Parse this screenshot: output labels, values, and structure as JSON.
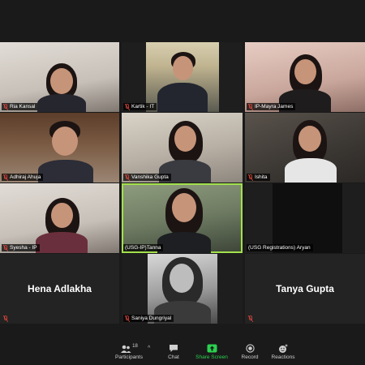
{
  "gallery": {
    "tiles": [
      {
        "name": "Ria Kansal",
        "muted": true
      },
      {
        "name": "Kartik - IT",
        "muted": true
      },
      {
        "name": "IP-Mayra James",
        "muted": true
      },
      {
        "name": "Adhiraj Ahuja",
        "muted": true
      },
      {
        "name": "Vanshika Gupta",
        "muted": true
      },
      {
        "name": "Ishita",
        "muted": true
      },
      {
        "name": "Syesha - IP",
        "muted": true
      },
      {
        "name": "(USG-IP)Tanna",
        "muted": false
      },
      {
        "name": "(USG Registrations) Aryan",
        "muted": false
      },
      {
        "name": "Hena Adlakha",
        "muted": true
      },
      {
        "name": "Saniya Dungriyal",
        "muted": true
      },
      {
        "name": "Tanya Gupta",
        "muted": true
      }
    ]
  },
  "toolbar": {
    "participants_label": "Participants",
    "participants_count": "18",
    "chat_label": "Chat",
    "share_label": "Share Screen",
    "record_label": "Record",
    "reactions_label": "Reactions",
    "caret": "^"
  },
  "colors": {
    "active_speaker": "#a3e14b",
    "share": "#2bd14f",
    "mute": "#e0463c"
  }
}
